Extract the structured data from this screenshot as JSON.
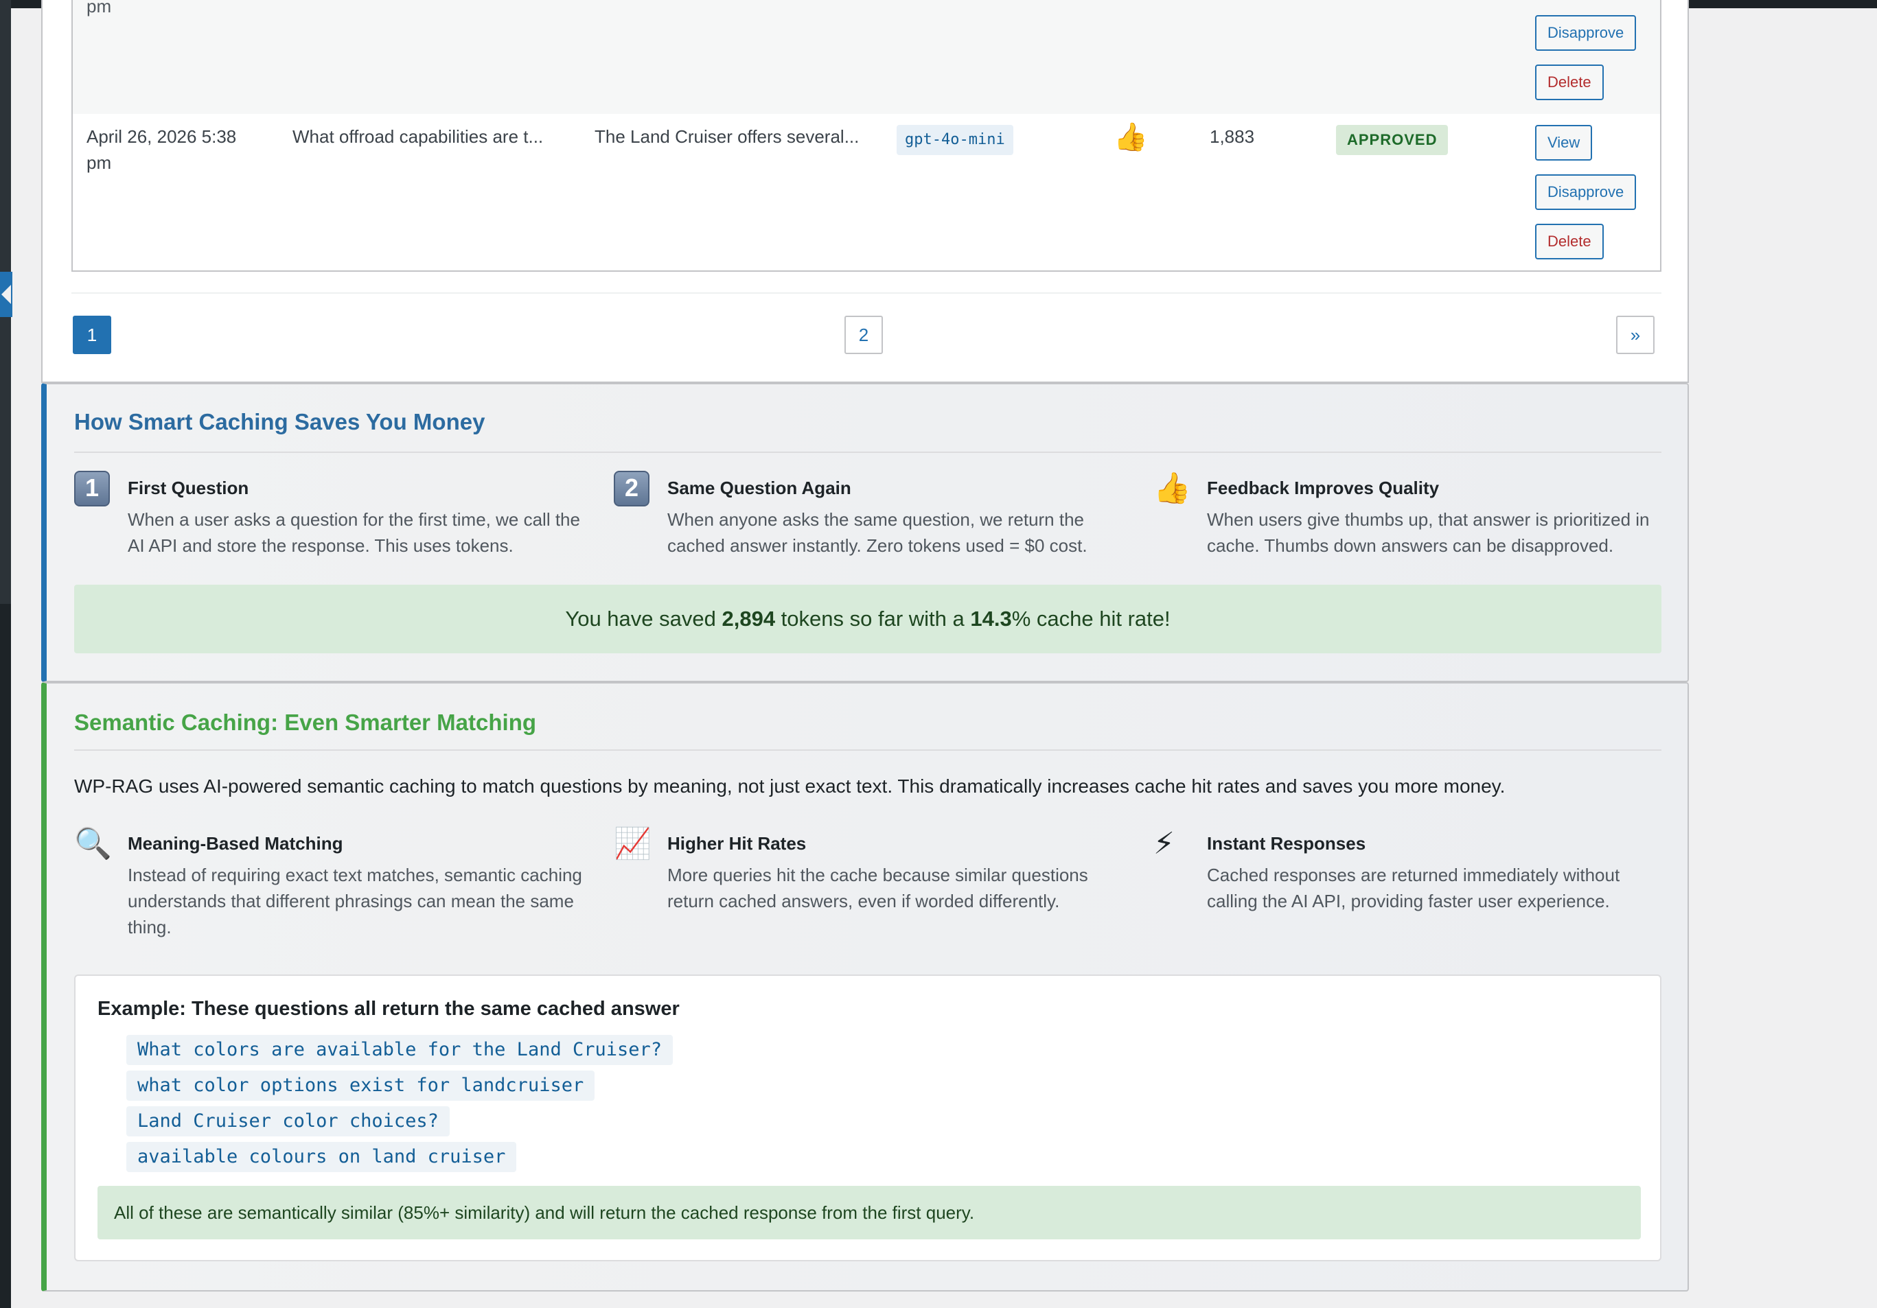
{
  "table": {
    "partial_row": {
      "date_fragment": "pm"
    },
    "row": {
      "date": "April 26, 2026 5:38 pm",
      "question": "What offroad capabilities are t...",
      "answer": "The Land Cruiser offers several...",
      "model": "gpt-4o-mini",
      "rating": "👍",
      "tokens": "1,883",
      "status": "APPROVED"
    },
    "actions": {
      "view": "View",
      "disapprove": "Disapprove",
      "delete": "Delete"
    }
  },
  "pagination": {
    "pages": [
      "1",
      "2"
    ],
    "current": "1",
    "next": "»"
  },
  "smart_caching": {
    "title": "How Smart Caching Saves You Money",
    "steps": [
      {
        "icon": "keycap-1-icon",
        "badge": "1",
        "title": "First Question",
        "description": "When a user asks a question for the first time, we call the AI API and store the response. This uses tokens."
      },
      {
        "icon": "keycap-2-icon",
        "badge": "2",
        "title": "Same Question Again",
        "description": "When anyone asks the same question, we return the cached answer instantly. Zero tokens used = $0 cost."
      },
      {
        "icon": "thumbs-up-icon",
        "badge": "👍",
        "title": "Feedback Improves Quality",
        "description": "When users give thumbs up, that answer is prioritized in cache. Thumbs down answers can be disapproved."
      }
    ],
    "savings": {
      "prefix": "You have saved ",
      "tokens": "2,894",
      "middle": " tokens so far with a ",
      "rate": "14.3",
      "suffix": "% cache hit rate!"
    }
  },
  "semantic_caching": {
    "title": "Semantic Caching: Even Smarter Matching",
    "intro": "WP-RAG uses AI-powered semantic caching to match questions by meaning, not just exact text. This dramatically increases cache hit rates and saves you more money.",
    "features": [
      {
        "icon": "magnifier-icon",
        "glyph": "🔍",
        "title": "Meaning-Based Matching",
        "description": "Instead of requiring exact text matches, semantic caching understands that different phrasings can mean the same thing."
      },
      {
        "icon": "chart-increasing-icon",
        "glyph": "📈",
        "title": "Higher Hit Rates",
        "description": "More queries hit the cache because similar questions return cached answers, even if worded differently."
      },
      {
        "icon": "lightning-icon",
        "glyph": "⚡",
        "title": "Instant Responses",
        "description": "Cached responses are returned immediately without calling the AI API, providing faster user experience."
      }
    ],
    "example": {
      "title": "Example: These questions all return the same cached answer",
      "questions": [
        "What colors are available for the Land Cruiser?",
        "what color options exist for landcruiser",
        "Land Cruiser color choices?",
        "available colours on land cruiser"
      ],
      "note": "All of these are semantically similar (85%+ similarity) and will return the cached response from the first query."
    }
  },
  "colors": {
    "accent_blue": "#2271b1",
    "accent_green": "#46a447",
    "success_bg": "#d8ebda",
    "danger": "#b32d2e"
  }
}
